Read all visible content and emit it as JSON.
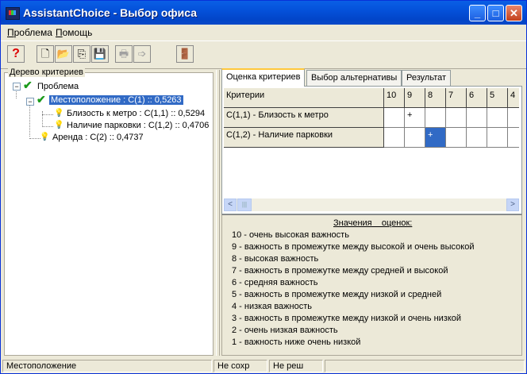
{
  "window": {
    "title": "AssistantChoice  -  Выбор офиса"
  },
  "titlebar_buttons": {
    "minimize": "_",
    "maximize": "□",
    "close": "✕"
  },
  "menu": [
    {
      "label": "Проблема",
      "accel": "П"
    },
    {
      "label": "Помощь",
      "accel": "П"
    }
  ],
  "toolbar": {
    "help": "?",
    "new": "🗋",
    "open": "📂",
    "import": "⎘",
    "save": "💾",
    "print": "🖶",
    "export": "➩",
    "exit": "🚪"
  },
  "tree": {
    "label": "Дерево критериев",
    "root": "Проблема",
    "nodes": [
      "Местоположение : C(1) :: 0,5263",
      "Близость к метро : C(1,1) :: 0,5294",
      "Наличие парковки : C(1,2) :: 0,4706",
      "Аренда : C(2) :: 0,4737"
    ],
    "expander": "−"
  },
  "tabs": [
    "Оценка критериев",
    "Выбор альтернативы",
    "Результат"
  ],
  "grid": {
    "header": "Критерии",
    "columns": [
      "10",
      "9",
      "8",
      "7",
      "6",
      "5",
      "4"
    ],
    "rows": [
      {
        "label": "C(1,1) - Близость к метро",
        "cells": [
          "",
          "+",
          "",
          "",
          "",
          "",
          ""
        ]
      },
      {
        "label": "C(1,2) - Наличие парковки",
        "cells": [
          "",
          "",
          "+",
          "",
          "",
          "",
          ""
        ]
      }
    ]
  },
  "scroll": {
    "left": "<",
    "right": ">",
    "thumb": "|||"
  },
  "legend": {
    "title": "Значения    оценок:",
    "items": [
      "10 - очень высокая важность",
      "9 - важность в промежутке между высокой и очень высокой",
      "8 - высокая важность",
      "7 - важность в промежутке между средней и высокой",
      "6 - средняя важность",
      "5 - важность в промежутке между низкой и средней",
      "4 - низкая важность",
      "3 - важность в промежутке между низкой и очень низкой",
      "2 - очень низкая важность",
      "1 - важность ниже очень низкой"
    ]
  },
  "status": {
    "node": "Местоположение",
    "saved": "Не сохр",
    "solved": "Не реш"
  }
}
